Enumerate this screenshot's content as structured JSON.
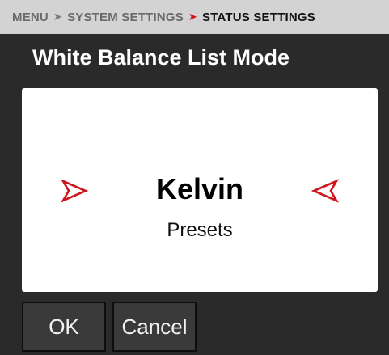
{
  "breadcrumb": {
    "items": [
      "MENU",
      "SYSTEM SETTINGS",
      "STATUS SETTINGS"
    ],
    "separator": "➤"
  },
  "title": "White Balance List Mode",
  "selector": {
    "selected": "Kelvin",
    "next_option": "Presets"
  },
  "buttons": {
    "ok": "OK",
    "cancel": "Cancel"
  },
  "colors": {
    "accent": "#d0141c",
    "background": "#2a2a2a",
    "header": "#d3d3d3"
  },
  "icons": {
    "left": "arrow-right-icon",
    "right": "arrow-left-icon"
  }
}
